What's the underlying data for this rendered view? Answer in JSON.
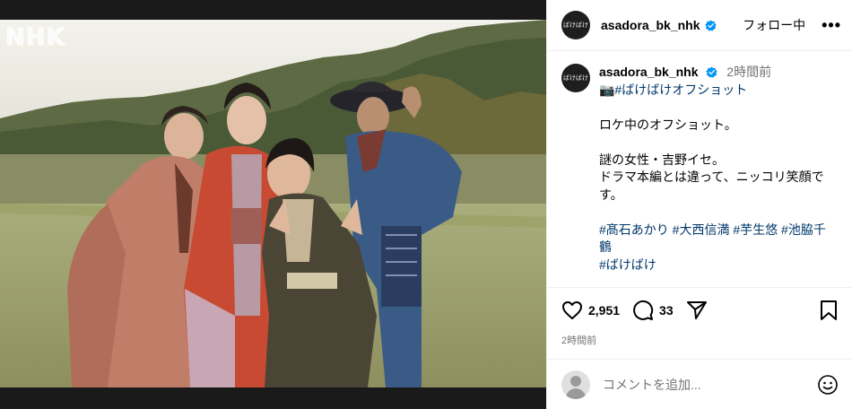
{
  "media": {
    "watermark": "NHK"
  },
  "header": {
    "avatar_text": "ばけばけ",
    "username": "asadora_bk_nhk",
    "follow_label": "フォロー中",
    "more_label": "•••"
  },
  "caption": {
    "username": "asadora_bk_nhk",
    "time": "2時間前",
    "title_line": "📷#ばけばけオフショット",
    "line1": "ロケ中のオフショット。",
    "line2": "謎の女性・吉野イセ。",
    "line3": "ドラマ本編とは違って、ニッコリ笑顔で",
    "line4": "す。",
    "hashtags1": "#髙石あかり #大西信満 #芋生悠 #池脇千",
    "hashtags2": "鶴",
    "hashtags3": "#ばけばけ"
  },
  "actions": {
    "likes": "2,951",
    "comments": "33",
    "posted": "2時間前"
  },
  "comment_box": {
    "placeholder": "コメントを追加..."
  },
  "colors": {
    "verified": "#0095f6",
    "hashtag": "#00376b",
    "muted": "#737373"
  }
}
